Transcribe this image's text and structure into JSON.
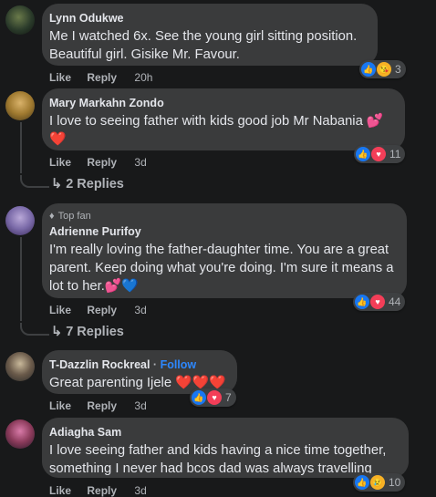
{
  "comments": [
    {
      "name": "Lynn Odukwe",
      "text": "Me I watched 6x. See the young girl sitting position. Beautiful girl. Gisike Mr. Favour.",
      "like": "Like",
      "reply": "Reply",
      "time": "20h",
      "reaction_count": "3",
      "reaction_icons": [
        "like-icon",
        "care-icon"
      ]
    },
    {
      "name": "Mary Markahn Zondo",
      "text": "I love to seeing father with kids good job Mr Nabania 💕",
      "text2": "❤️",
      "like": "Like",
      "reply": "Reply",
      "time": "3d",
      "reaction_count": "11",
      "reaction_icons": [
        "like-icon",
        "love-icon"
      ],
      "replies_label": "2 Replies"
    },
    {
      "badge": "Top fan",
      "name": "Adrienne Purifoy",
      "text": "I'm really loving the father-daughter time. You are a great parent. Keep doing what you're doing. I'm sure it means a lot to her.💕💙",
      "like": "Like",
      "reply": "Reply",
      "time": "3d",
      "reaction_count": "44",
      "reaction_icons": [
        "like-icon",
        "love-icon"
      ],
      "replies_label": "7 Replies"
    },
    {
      "name": "T-Dazzlin Rockreal",
      "follow": "Follow",
      "text": "Great parenting Ijele ❤️❤️❤️",
      "like": "Like",
      "reply": "Reply",
      "time": "3d",
      "reaction_count": "7",
      "reaction_icons": [
        "like-icon",
        "love-icon"
      ]
    },
    {
      "name": "Adiagha Sam",
      "text": "I love seeing father and kids having a nice time together, something I never had bcos dad was always travelling",
      "like": "Like",
      "reply": "Reply",
      "time": "3d",
      "reaction_count": "10",
      "reaction_icons": [
        "like-icon",
        "care-icon"
      ]
    }
  ],
  "colors": {
    "background": "#18191a",
    "bubble": "#3a3b3c",
    "link": "#2d88ff",
    "like": "#1877f2",
    "love": "#f33e58"
  }
}
